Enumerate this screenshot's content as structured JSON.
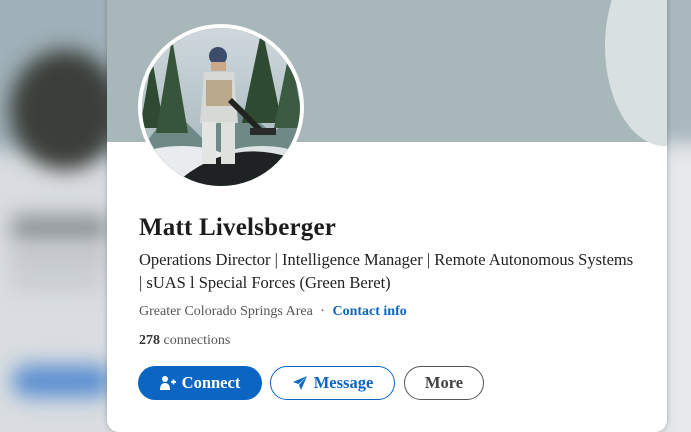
{
  "profile": {
    "name": "Matt Livelsberger",
    "headline": "Operations Director | Intelligence Manager | Remote Autonomous Systems | sUAS l Special Forces (Green Beret)",
    "location": "Greater Colorado Springs Area",
    "separator": "·",
    "contact_info_label": "Contact info",
    "connections_count": "278",
    "connections_label": "connections"
  },
  "actions": {
    "connect_label": "Connect",
    "message_label": "Message",
    "more_label": "More"
  },
  "icons": {
    "connect": "person-add-icon",
    "message": "paper-plane-icon"
  },
  "colors": {
    "accent": "#0a66c2",
    "banner": "#a8b8ba"
  }
}
